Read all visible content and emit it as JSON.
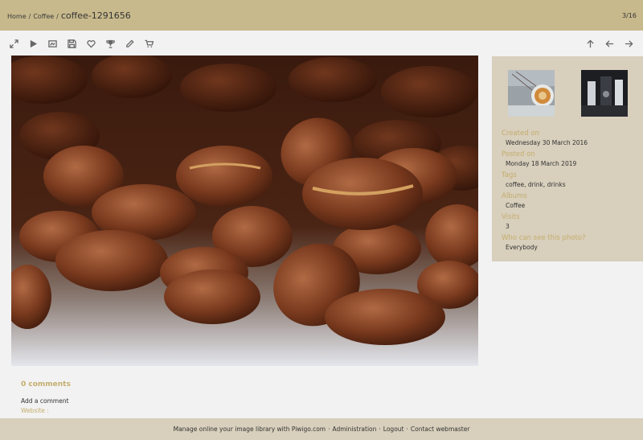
{
  "breadcrumb": {
    "home": "Home",
    "album": "Coffee",
    "separator": "/",
    "current": "coffee-1291656"
  },
  "counter": "3/16",
  "toolbar": {
    "left": [
      "expand-icon",
      "play-icon",
      "image-info-icon",
      "save-icon",
      "heart-icon",
      "trophy-icon",
      "pencil-icon",
      "cart-icon"
    ],
    "right": [
      "arrow-up-icon",
      "arrow-left-icon",
      "arrow-right-icon"
    ]
  },
  "info": {
    "created_label": "Created on",
    "created_value": "Wednesday 30 March 2016",
    "posted_label": "Posted on",
    "posted_value": "Monday 18 March 2019",
    "tags_label": "Tags",
    "tags_value": "coffee, drink, drinks",
    "albums_label": "Albums",
    "albums_value": "Coffee",
    "visits_label": "Visits",
    "visits_value": "3",
    "visibility_label": "Who can see this photo?",
    "visibility_value": "Everybody"
  },
  "comments": {
    "title": "0 comments",
    "add": "Add a comment",
    "website_label": "Website :"
  },
  "footer": {
    "text": "Manage online your image library with Piwigo.com",
    "sep": "·",
    "admin": "Administration",
    "logout": "Logout",
    "contact": "Contact webmaster"
  },
  "colors": {
    "header": "#c8b98c",
    "panel": "#d8cfbc",
    "accent": "#c4ad6d",
    "background": "#f2f2f2"
  }
}
